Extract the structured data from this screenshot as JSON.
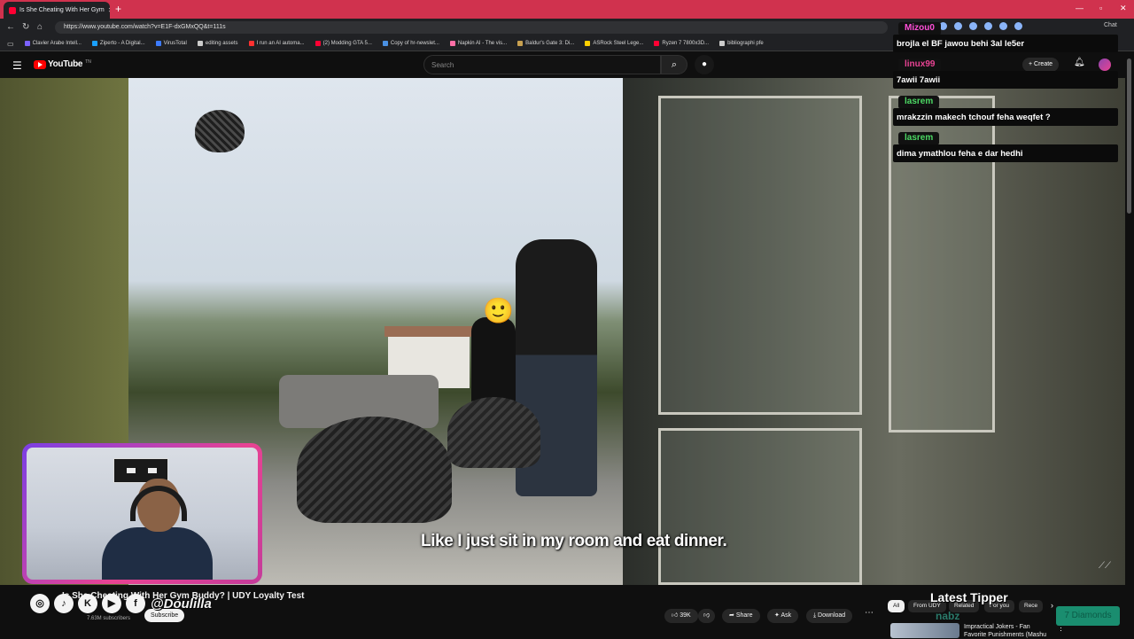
{
  "browser": {
    "tab_title": "Is She Cheating With Her Gym",
    "url": "https://www.youtube.com/watch?v=E1F-dxGMxQQ&t=111s",
    "bookmarks": [
      {
        "label": "Clavier Arabe Intell...",
        "color": "#7b61ff"
      },
      {
        "label": "Ziperto - A Digital...",
        "color": "#1aa0ff"
      },
      {
        "label": "VirusTotal",
        "color": "#3d7bff"
      },
      {
        "label": "editing assets",
        "color": "#cccccc"
      },
      {
        "label": "I run an AI automa...",
        "color": "#ff3030"
      },
      {
        "label": "(2) Modding GTA 5...",
        "color": "#ff0033"
      },
      {
        "label": "Copy of hr-newslet...",
        "color": "#4a90e2"
      },
      {
        "label": "Napkin AI - The vis...",
        "color": "#ff6fa7"
      },
      {
        "label": "Baldur's Gate 3: Di...",
        "color": "#c8a050"
      },
      {
        "label": "ASRock Steel Lege...",
        "color": "#ffd000"
      },
      {
        "label": "Ryzen 7 7800x3D...",
        "color": "#ff0033"
      },
      {
        "label": "bibliographi pfe",
        "color": "#cccccc"
      }
    ],
    "chat_label": "Chat"
  },
  "youtube": {
    "logo_text": "YouTube",
    "logo_tn": "TN",
    "search_placeholder": "Search",
    "create_label": "Create"
  },
  "video": {
    "subtitle": "Like I just sit in my room and eat dinner.",
    "title": "Is She Cheating With Her Gym Buddy? | UDY Loyalty Test",
    "subscribers": "7.63M subscribers",
    "subscribe_label": "Subscribe",
    "likes": "39K",
    "share_label": "Share",
    "ask_label": "Ask",
    "download_label": "Download"
  },
  "overlay": {
    "handle": "@Doulilla",
    "latest_tipper_title": "Latest Tipper",
    "tipper_name": "nabz",
    "tipper_amount": "7 Diamonds"
  },
  "chips": [
    "All",
    "From UDY",
    "Related",
    "For you",
    "Rece"
  ],
  "recommendation": {
    "title": "Impractical Jokers - Fan Favorite Punishments (Mashu"
  },
  "chat": [
    {
      "user": "Mizou0",
      "color": "#ff4fd8",
      "message": "brojla el BF jawou behi 3al le5er"
    },
    {
      "user": "linux99",
      "color": "#e84393",
      "message": "7awii 7awii"
    },
    {
      "user": "lasrem",
      "color": "#4cd964",
      "message": "mrakzzin makech tchouf feha weqfet ?"
    },
    {
      "user": "lasrem",
      "color": "#4cd964",
      "message": "dima ymathlou feha e dar hedhi"
    }
  ]
}
